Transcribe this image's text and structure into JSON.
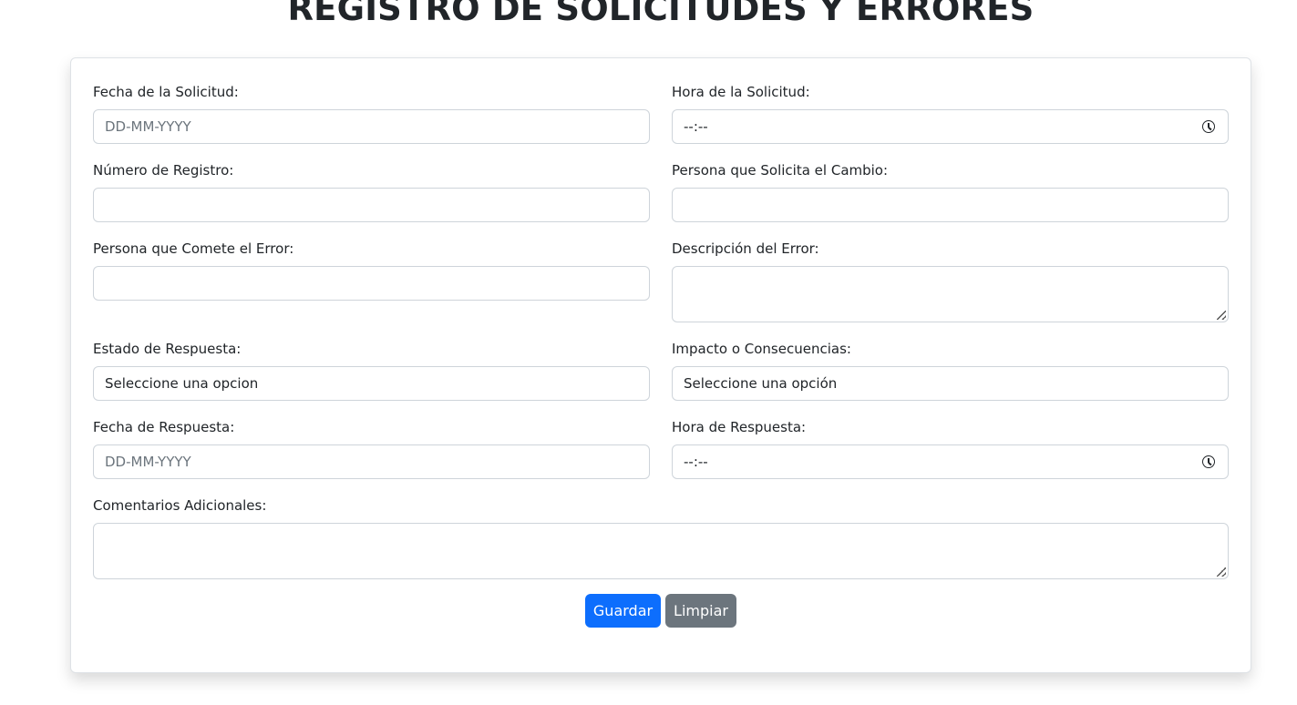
{
  "page": {
    "title": "REGISTRO DE SOLICITUDES Y ERRORES"
  },
  "form": {
    "fecha_solicitud": {
      "label": "Fecha de la Solicitud:",
      "placeholder": "DD-MM-YYYY",
      "value": ""
    },
    "hora_solicitud": {
      "label": "Hora de la Solicitud:",
      "value": "--:--",
      "icon": "clock-icon"
    },
    "numero_registro": {
      "label": "Número de Registro:",
      "value": ""
    },
    "persona_solicita": {
      "label": "Persona que Solicita el Cambio:",
      "value": ""
    },
    "persona_error": {
      "label": "Persona que Comete el Error:",
      "value": ""
    },
    "descripcion_error": {
      "label": "Descripción del Error:",
      "value": ""
    },
    "estado_respuesta": {
      "label": "Estado de Respuesta:",
      "selected": "Seleccione una opcion"
    },
    "impacto": {
      "label": "Impacto o Consecuencias:",
      "selected": "Seleccione una opción"
    },
    "fecha_respuesta": {
      "label": "Fecha de Respuesta:",
      "placeholder": "DD-MM-YYYY",
      "value": ""
    },
    "hora_respuesta": {
      "label": "Hora de Respuesta:",
      "value": "--:--",
      "icon": "clock-icon"
    },
    "comentarios": {
      "label": "Comentarios Adicionales:",
      "value": ""
    }
  },
  "buttons": {
    "guardar": "Guardar",
    "limpiar": "Limpiar"
  },
  "colors": {
    "primary": "#0d6efd",
    "secondary": "#6c757d",
    "border": "#ced4da",
    "text": "#212529"
  }
}
